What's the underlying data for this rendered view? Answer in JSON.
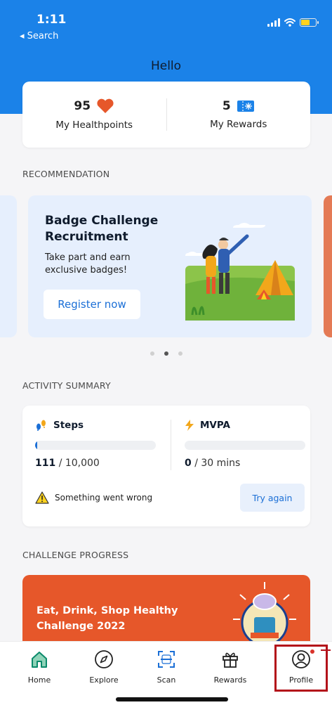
{
  "status_bar": {
    "time": "1:11",
    "back_label": "◂ Search"
  },
  "header": {
    "title": "Hello"
  },
  "summary": {
    "healthpoints": {
      "value": "95",
      "label": "My Healthpoints",
      "icon": "heart-icon"
    },
    "rewards": {
      "value": "5",
      "label": "My Rewards",
      "icon": "ticket-icon"
    }
  },
  "recommendation": {
    "section_title": "RECOMMENDATION",
    "card": {
      "title": "Badge Challenge Recruitment",
      "subtitle": "Take part and earn exclusive badges!",
      "button": "Register now"
    },
    "page_count": 3,
    "active_page": 1
  },
  "activity": {
    "section_title": "ACTIVITY SUMMARY",
    "steps": {
      "label": "Steps",
      "current": "111",
      "goal": "/ 10,000",
      "progress": 0.011
    },
    "mvpa": {
      "label": "MVPA",
      "current": "0",
      "goal": "/ 30 mins",
      "progress": 0
    },
    "error_text": "Something went wrong",
    "retry_button": "Try again"
  },
  "challenge": {
    "section_title": "CHALLENGE PROGRESS",
    "title": "Eat, Drink, Shop Healthy Challenge 2022"
  },
  "nav": {
    "items": [
      {
        "label": "Home",
        "icon": "home-icon"
      },
      {
        "label": "Explore",
        "icon": "compass-icon"
      },
      {
        "label": "Scan",
        "icon": "scan-icon"
      },
      {
        "label": "Rewards",
        "icon": "gift-icon"
      },
      {
        "label": "Profile",
        "icon": "user-icon"
      }
    ]
  },
  "colors": {
    "header": "#1b82e8",
    "accent_blue": "#1b6fd6",
    "heart": "#e6572a",
    "challenge": "#e6572a",
    "highlight": "#b3121a",
    "nav_home": "#0b8a6b"
  }
}
